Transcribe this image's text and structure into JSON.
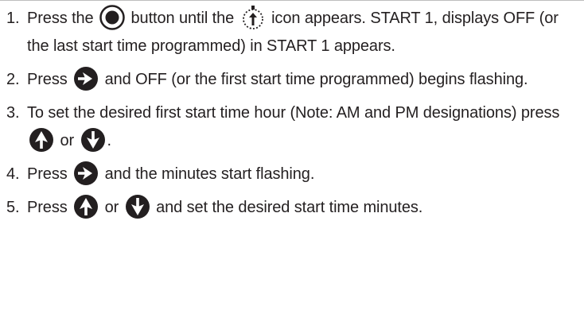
{
  "steps": [
    {
      "number": "1.",
      "parts": [
        "Press the",
        "button until the",
        "icon appears. START 1, displays OFF (or the last start time programmed) in START 1 appears."
      ],
      "icons": [
        "mode-dial-button-icon",
        "stopwatch-start-icon"
      ]
    },
    {
      "number": "2.",
      "parts": [
        "Press",
        "and OFF (or the first start time programmed) begins flashing."
      ],
      "icons": [
        "right-arrow-button-icon"
      ]
    },
    {
      "number": "3.",
      "parts": [
        "To set the desired first start time hour (Note: AM and PM designations) press",
        "or",
        "."
      ],
      "icons": [
        "up-arrow-button-icon",
        "down-arrow-button-icon"
      ]
    },
    {
      "number": "4.",
      "parts": [
        "Press",
        "and the minutes start flashing."
      ],
      "icons": [
        "right-arrow-button-icon"
      ]
    },
    {
      "number": "5.",
      "parts": [
        "Press",
        "or",
        "and set the desired start time minutes."
      ],
      "icons": [
        "up-arrow-button-icon",
        "down-arrow-button-icon"
      ]
    }
  ]
}
